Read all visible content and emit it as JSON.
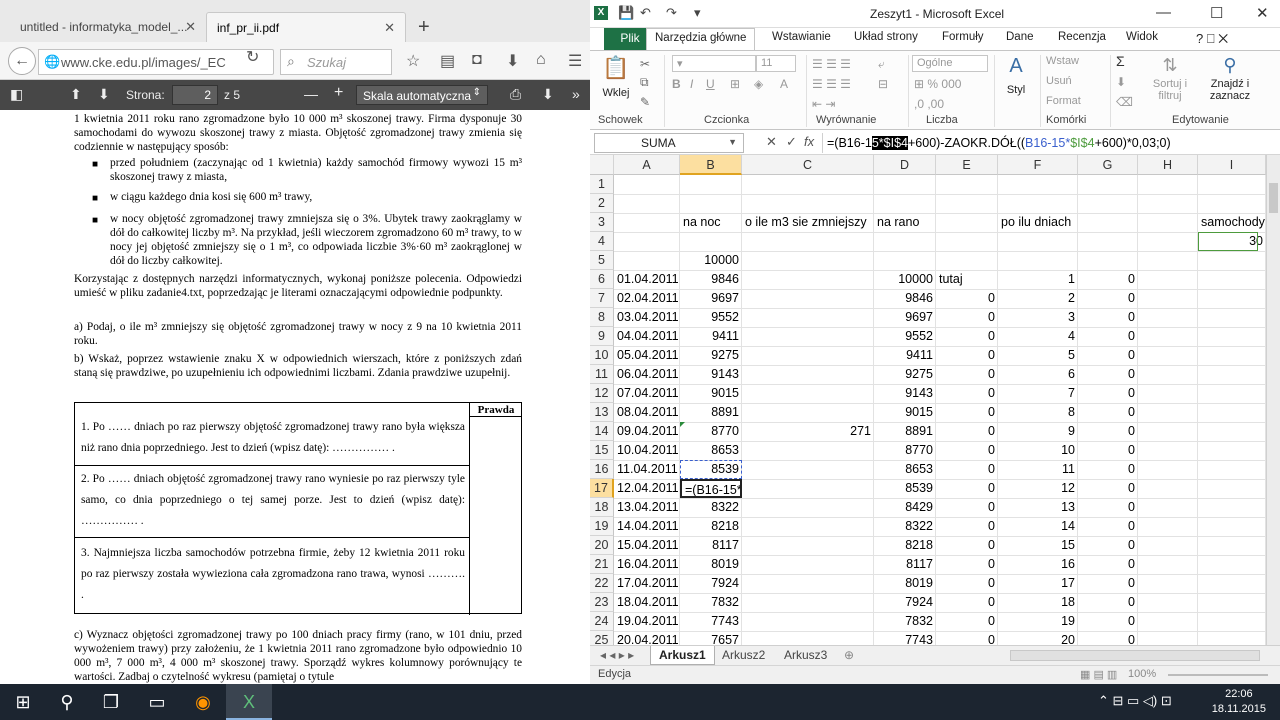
{
  "browser": {
    "tabs": [
      {
        "label": "untitled - informatyka_model_..."
      },
      {
        "label": "inf_pr_ii.pdf"
      }
    ],
    "url": "www.cke.edu.pl/images/_EC",
    "search_placeholder": "Szukaj",
    "pdf_toolbar": {
      "page_label": "Strona:",
      "page_value": "2",
      "page_total": "z 5",
      "zoom_value": "Skala automatyczna"
    }
  },
  "pdf": {
    "para1": "1 kwietnia 2011 roku rano zgromadzone było 10 000 m³ skoszonej trawy. Firma dysponuje 30 samochodami do wywozu skoszonej trawy z miasta. Objętość zgromadzonej trawy zmienia się codziennie w następujący sposób:",
    "bullets": [
      "przed południem (zaczynając od 1 kwietnia) każdy samochód firmowy wywozi 15 m³ skoszonej trawy z miasta,",
      "w ciągu każdego dnia kosi się 600 m³ trawy,",
      "w nocy objętość zgromadzonej trawy zmniejsza się o 3%. Ubytek trawy zaokrąglamy w dół do całkowitej liczby m³. Na przykład, jeśli wieczorem zgromadzono 60 m³ trawy, to w nocy jej objętość zmniejszy się o 1 m³, co odpowiada liczbie 3%·60 m³ zaokrąglonej w dół do liczby całkowitej."
    ],
    "para2": "Korzystając z dostępnych narzędzi informatycznych, wykonaj poniższe polecenia. Odpowiedzi umieść w pliku zadanie4.txt, poprzedzając je literami oznaczającymi odpowiednie podpunkty.",
    "task_a": "a)  Podaj, o ile m³ zmniejszy się objętość zgromadzonej trawy w nocy z 9 na 10 kwietnia 2011 roku.",
    "task_b": "b)  Wskaż, poprzez wstawienie znaku X w odpowiednich wierszach, które z poniższych zdań staną się prawdziwe, po uzupełnieniu ich odpowiednimi liczbami. Zdania prawdziwe uzupełnij.",
    "table_header": "Prawda",
    "table_rows": [
      "1.  Po …… dniach po raz pierwszy objętość zgromadzonej trawy rano była większa niż rano dnia poprzedniego. Jest to dzień (wpisz datę): …………… .",
      "2.  Po …… dniach objętość zgromadzonej trawy rano wyniesie po raz pierwszy tyle samo, co dnia poprzedniego o tej samej porze. Jest to dzień (wpisz datę): …………… .",
      "3.  Najmniejsza liczba samochodów potrzebna firmie, żeby 12 kwietnia 2011 roku po raz pierwszy została wywieziona cała zgromadzona rano trawa, wynosi ………. ."
    ],
    "task_c": "c)  Wyznacz objętości zgromadzonej trawy po 100 dniach pracy firmy (rano, w 101 dniu, przed wywożeniem trawy) przy założeniu, że 1 kwietnia 2011 rano zgromadzone było odpowiednio 10 000 m³, 7 000 m³, 4 000 m³ skoszonej trawy. Sporządź wykres kolumnowy porównujący te wartości. Zadbaj o czytelność wykresu (pamiętaj o tytule"
  },
  "excel": {
    "title": "Zeszyt1 - Microsoft Excel",
    "file_tab": "Plik",
    "ribbon_tabs": [
      "Narzędzia główne",
      "Wstawianie",
      "Układ strony",
      "Formuły",
      "Dane",
      "Recenzja",
      "Widok",
      "Komórki"
    ],
    "ribbon": {
      "paste": "Wklej",
      "font_size": "11",
      "number_format": "Ogólne",
      "style": "Styl",
      "insert": "Wstaw",
      "delete": "Usuń",
      "format": "Format",
      "sort": "Sortuj i filtruj",
      "find": "Znajdź i zaznacz",
      "groups": [
        "Schowek",
        "Czcionka",
        "Wyrównanie",
        "Liczba",
        "Komórki",
        "Edytowanie"
      ]
    },
    "name_box": "SUMA",
    "formula": {
      "p1": "=(B16-1",
      "p2": "5*$I$4",
      "p3": "+600)-ZAOKR.DÓŁ((",
      "p4": "B16-15*",
      "p5": "$I$4",
      "p6": "+600)*0,03;0)"
    },
    "columns": [
      "A",
      "B",
      "C",
      "D",
      "E",
      "F",
      "G",
      "H",
      "I"
    ],
    "header_row": {
      "B": "na noc",
      "C": "o ile m3 sie zmniejszy",
      "D": "na rano",
      "F": "po ilu dniach",
      "I": "samochody"
    },
    "I4": "30",
    "B5": "10000",
    "E6": "tutaj",
    "C14": "271",
    "editing_cell": "=(B16-15*",
    "rows": [
      {
        "r": "6",
        "A": "01.04.2011",
        "B": "9846",
        "D": "10000",
        "E": "",
        "F": "1",
        "G": "0"
      },
      {
        "r": "7",
        "A": "02.04.2011",
        "B": "9697",
        "D": "9846",
        "E": "0",
        "F": "2",
        "G": "0"
      },
      {
        "r": "8",
        "A": "03.04.2011",
        "B": "9552",
        "D": "9697",
        "E": "0",
        "F": "3",
        "G": "0"
      },
      {
        "r": "9",
        "A": "04.04.2011",
        "B": "9411",
        "D": "9552",
        "E": "0",
        "F": "4",
        "G": "0"
      },
      {
        "r": "10",
        "A": "05.04.2011",
        "B": "9275",
        "D": "9411",
        "E": "0",
        "F": "5",
        "G": "0"
      },
      {
        "r": "11",
        "A": "06.04.2011",
        "B": "9143",
        "D": "9275",
        "E": "0",
        "F": "6",
        "G": "0"
      },
      {
        "r": "12",
        "A": "07.04.2011",
        "B": "9015",
        "D": "9143",
        "E": "0",
        "F": "7",
        "G": "0"
      },
      {
        "r": "13",
        "A": "08.04.2011",
        "B": "8891",
        "D": "9015",
        "E": "0",
        "F": "8",
        "G": "0"
      },
      {
        "r": "14",
        "A": "09.04.2011",
        "B": "8770",
        "D": "8891",
        "E": "0",
        "F": "9",
        "G": "0"
      },
      {
        "r": "15",
        "A": "10.04.2011",
        "B": "8653",
        "D": "8770",
        "E": "0",
        "F": "10",
        "G": "0"
      },
      {
        "r": "16",
        "A": "11.04.2011",
        "B": "8539",
        "D": "8653",
        "E": "0",
        "F": "11",
        "G": "0"
      },
      {
        "r": "17",
        "A": "12.04.2011",
        "B": "",
        "D": "8539",
        "E": "0",
        "F": "12",
        "G": "0"
      },
      {
        "r": "18",
        "A": "13.04.2011",
        "B": "8322",
        "D": "8429",
        "E": "0",
        "F": "13",
        "G": "0"
      },
      {
        "r": "19",
        "A": "14.04.2011",
        "B": "8218",
        "D": "8322",
        "E": "0",
        "F": "14",
        "G": "0"
      },
      {
        "r": "20",
        "A": "15.04.2011",
        "B": "8117",
        "D": "8218",
        "E": "0",
        "F": "15",
        "G": "0"
      },
      {
        "r": "21",
        "A": "16.04.2011",
        "B": "8019",
        "D": "8117",
        "E": "0",
        "F": "16",
        "G": "0"
      },
      {
        "r": "22",
        "A": "17.04.2011",
        "B": "7924",
        "D": "8019",
        "E": "0",
        "F": "17",
        "G": "0"
      },
      {
        "r": "23",
        "A": "18.04.2011",
        "B": "7832",
        "D": "7924",
        "E": "0",
        "F": "18",
        "G": "0"
      },
      {
        "r": "24",
        "A": "19.04.2011",
        "B": "7743",
        "D": "7832",
        "E": "0",
        "F": "19",
        "G": "0"
      },
      {
        "r": "25",
        "A": "20.04.2011",
        "B": "7657",
        "D": "7743",
        "E": "0",
        "F": "20",
        "G": "0"
      }
    ],
    "sheets": [
      "Arkusz1",
      "Arkusz2",
      "Arkusz3"
    ],
    "status": "Edycja",
    "zoom": "100%",
    "colors": {
      "accent": "#1e7145",
      "selection": "#fcdfa0"
    }
  },
  "taskbar": {
    "time": "22:06",
    "date": "18.11.2015"
  }
}
